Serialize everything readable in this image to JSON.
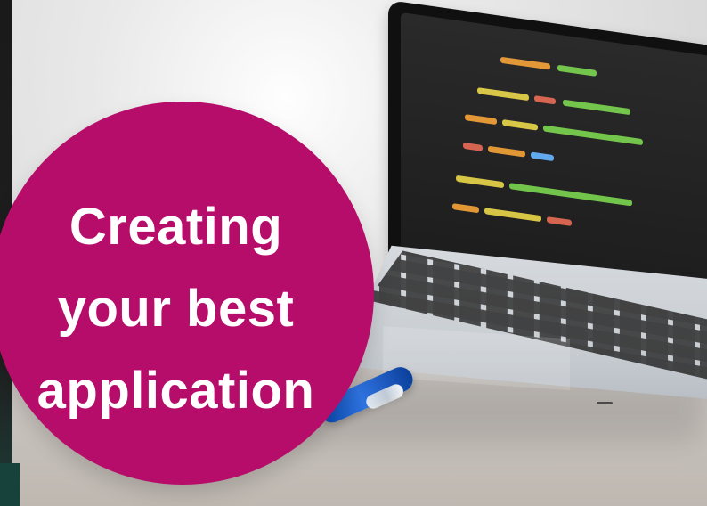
{
  "overlay": {
    "lines": [
      "Creating",
      "your best",
      "application"
    ]
  },
  "colors": {
    "badge_magenta": "#b60d6a",
    "text": "#ffffff"
  }
}
